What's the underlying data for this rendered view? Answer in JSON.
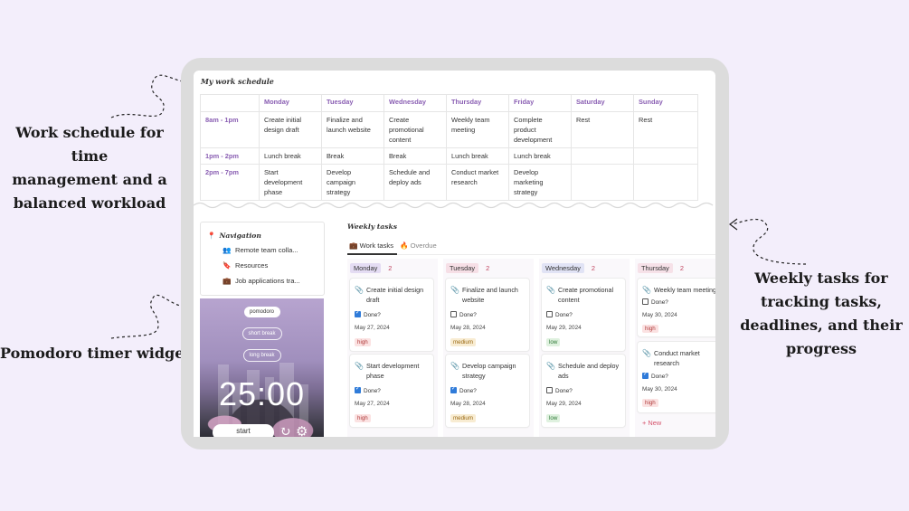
{
  "annotations": {
    "schedule": [
      "Work schedule for time",
      "management and a",
      "balanced workload"
    ],
    "pomodoro": "Pomodoro timer widget",
    "weekly": [
      "Weekly tasks for",
      "tracking tasks,",
      "deadlines, and their",
      "progress"
    ]
  },
  "schedule": {
    "title": "My work schedule",
    "days": [
      "Monday",
      "Tuesday",
      "Wednesday",
      "Thursday",
      "Friday",
      "Saturday",
      "Sunday"
    ],
    "rows": [
      {
        "time": "8am - 1pm",
        "cells": [
          "Create initial design draft",
          "Finalize and launch website",
          "Create promotional content",
          "Weekly team meeting",
          "Complete product development",
          "Rest",
          "Rest"
        ]
      },
      {
        "time": "1pm - 2pm",
        "cells": [
          "Lunch break",
          "Break",
          "Break",
          "Lunch break",
          "Lunch break",
          "",
          ""
        ]
      },
      {
        "time": "2pm - 7pm",
        "cells": [
          "Start development phase",
          "Develop campaign strategy",
          "Schedule and deploy ads",
          "Conduct market research",
          "Develop marketing strategy",
          "",
          ""
        ]
      }
    ]
  },
  "navigation": {
    "title": "Navigation",
    "items": [
      {
        "label": "Remote team colla...",
        "icon": "people-icon"
      },
      {
        "label": "Resources",
        "icon": "bookmark-icon"
      },
      {
        "label": "Job applications tra...",
        "icon": "briefcase-icon"
      }
    ]
  },
  "pomodoro": {
    "modes": [
      "pomodoro",
      "short break",
      "long break"
    ],
    "active_mode": "pomodoro",
    "time": "25:00",
    "start_label": "start"
  },
  "weekly": {
    "title": "Weekly tasks",
    "tabs": [
      "Work tasks",
      "Overdue"
    ],
    "done_label": "Done?",
    "new_label": "+ New",
    "columns": [
      {
        "day": "Monday",
        "count": "2",
        "color": "#e4dcf3",
        "tasks": [
          {
            "name": "Create initial design draft",
            "done": true,
            "date": "May 27, 2024",
            "priority": "high"
          },
          {
            "name": "Start development phase",
            "done": true,
            "date": "May 27, 2024",
            "priority": "high"
          }
        ]
      },
      {
        "day": "Tuesday",
        "count": "2",
        "color": "#f6dfe6",
        "tasks": [
          {
            "name": "Finalize and launch website",
            "done": false,
            "date": "May 28, 2024",
            "priority": "medium"
          },
          {
            "name": "Develop campaign strategy",
            "done": true,
            "date": "May 28, 2024",
            "priority": "medium"
          }
        ]
      },
      {
        "day": "Wednesday",
        "count": "2",
        "color": "#e1e3f5",
        "tasks": [
          {
            "name": "Create promotional content",
            "done": false,
            "date": "May 29, 2024",
            "priority": "low"
          },
          {
            "name": "Schedule and deploy ads",
            "done": false,
            "date": "May 29, 2024",
            "priority": "low"
          }
        ]
      },
      {
        "day": "Thursday",
        "count": "2",
        "color": "#f6e1e8",
        "tasks": [
          {
            "name": "Weekly team meeting",
            "done": false,
            "date": "May 30, 2024",
            "priority": "high"
          },
          {
            "name": "Conduct market research",
            "done": true,
            "date": "May 30, 2024",
            "priority": "high"
          }
        ]
      }
    ]
  }
}
